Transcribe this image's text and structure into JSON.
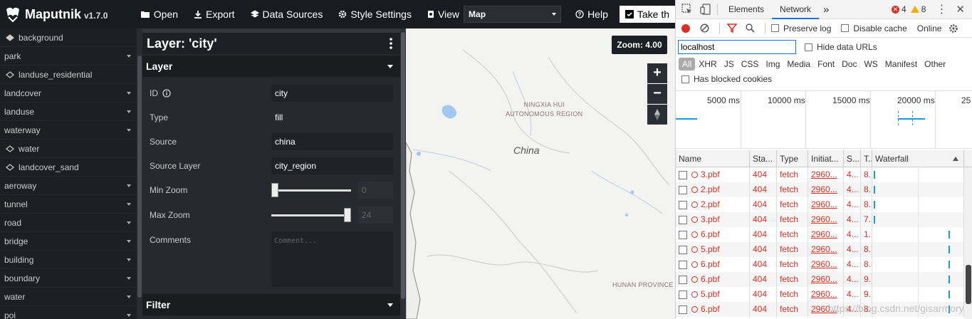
{
  "app": {
    "name": "Maputnik",
    "version": "v1.7.0"
  },
  "toolbar": {
    "open": "Open",
    "export": "Export",
    "data_sources": "Data Sources",
    "style_settings": "Style Settings",
    "view": "View",
    "view_select": "Map",
    "help": "Help",
    "take_tour": "Take th"
  },
  "layers": [
    {
      "label": "background",
      "kind": "icon-filled"
    },
    {
      "label": "park",
      "kind": "group"
    },
    {
      "label": "landuse_residential",
      "kind": "icon-outline"
    },
    {
      "label": "landcover",
      "kind": "group"
    },
    {
      "label": "landuse",
      "kind": "group"
    },
    {
      "label": "waterway",
      "kind": "group"
    },
    {
      "label": "water",
      "kind": "icon-outline"
    },
    {
      "label": "landcover_sand",
      "kind": "icon-outline"
    },
    {
      "label": "aeroway",
      "kind": "group"
    },
    {
      "label": "tunnel",
      "kind": "group"
    },
    {
      "label": "road",
      "kind": "group"
    },
    {
      "label": "bridge",
      "kind": "group"
    },
    {
      "label": "building",
      "kind": "group"
    },
    {
      "label": "boundary",
      "kind": "group"
    },
    {
      "label": "water",
      "kind": "group"
    },
    {
      "label": "poi",
      "kind": "group"
    }
  ],
  "editor": {
    "title": "Layer: 'city'",
    "section_layer": "Layer",
    "section_filter": "Filter",
    "props": {
      "id_label": "ID",
      "id_value": "city",
      "type_label": "Type",
      "type_value": "fill",
      "source_label": "Source",
      "source_value": "china",
      "source_layer_label": "Source Layer",
      "source_layer_value": "city_region",
      "min_zoom_label": "Min Zoom",
      "min_zoom_value": "0",
      "max_zoom_label": "Max Zoom",
      "max_zoom_value": "24",
      "comments_label": "Comments",
      "comments_placeholder": "Comment..."
    },
    "min_zoom_fraction": 0.0,
    "max_zoom_fraction": 1.0
  },
  "map": {
    "zoom_badge": "Zoom: 4.00",
    "zoom_in": "+",
    "zoom_out": "−",
    "label_ningxia_1": "NINGXIA HUI",
    "label_ningxia_2": "AUTONOMOUS REGION",
    "label_china": "China",
    "label_hunan": "HUNAN PROVINCE"
  },
  "devtools": {
    "tabs": [
      "Elements",
      "Network"
    ],
    "more": "»",
    "errors": "4",
    "warnings": "8",
    "preserve_log": "Preserve log",
    "disable_cache": "Disable cache",
    "online": "Online",
    "filter_value": "localhost",
    "hide_data_urls": "Hide data URLs",
    "types": [
      "All",
      "XHR",
      "JS",
      "CSS",
      "Img",
      "Media",
      "Font",
      "Doc",
      "WS",
      "Manifest",
      "Other"
    ],
    "has_blocked_cookies": "Has blocked cookies",
    "timeline_labels": [
      "5000 ms",
      "10000 ms",
      "15000 ms",
      "20000 ms",
      "25"
    ],
    "columns": [
      "Name",
      "Sta...",
      "Type",
      "Initiat...",
      "S...",
      "T...",
      "Waterfall"
    ],
    "rows": [
      {
        "name": "3.pbf",
        "status": "404",
        "type": "fetch",
        "initiator": "2960...",
        "size": "4...",
        "time": "8...",
        "wf": 0.02
      },
      {
        "name": "2.pbf",
        "status": "404",
        "type": "fetch",
        "initiator": "2960...",
        "size": "4...",
        "time": "8...",
        "wf": 0.02
      },
      {
        "name": "2.pbf",
        "status": "404",
        "type": "fetch",
        "initiator": "2960...",
        "size": "4...",
        "time": "8...",
        "wf": 0.02
      },
      {
        "name": "3.pbf",
        "status": "404",
        "type": "fetch",
        "initiator": "2960...",
        "size": "4...",
        "time": "7...",
        "wf": 0.02
      },
      {
        "name": "6.pbf",
        "status": "404",
        "type": "fetch",
        "initiator": "2960...",
        "size": "4...",
        "time": "1...",
        "wf": 0.93
      },
      {
        "name": "5.pbf",
        "status": "404",
        "type": "fetch",
        "initiator": "2960...",
        "size": "4...",
        "time": "8...",
        "wf": 0.93
      },
      {
        "name": "6.pbf",
        "status": "404",
        "type": "fetch",
        "initiator": "2960...",
        "size": "4...",
        "time": "8...",
        "wf": 0.93
      },
      {
        "name": "6.pbf",
        "status": "404",
        "type": "fetch",
        "initiator": "2960...",
        "size": "4...",
        "time": "9...",
        "wf": 0.93
      },
      {
        "name": "5.pbf",
        "status": "404",
        "type": "fetch",
        "initiator": "2960...",
        "size": "4...",
        "time": "9...",
        "wf": 0.93
      },
      {
        "name": "6.pbf",
        "status": "404",
        "type": "fetch",
        "initiator": "2960...",
        "size": "4...",
        "time": "8...",
        "wf": 0.93
      }
    ],
    "watermark": "https://blog.csdn.net/gisarmory"
  },
  "colors": {
    "accent": "#1a73e8",
    "error": "#d93025",
    "record": "#d93025",
    "waterfall": "#1a9ae0",
    "map_bg": "#f3f3f2",
    "map_water": "#a0c8f0"
  }
}
